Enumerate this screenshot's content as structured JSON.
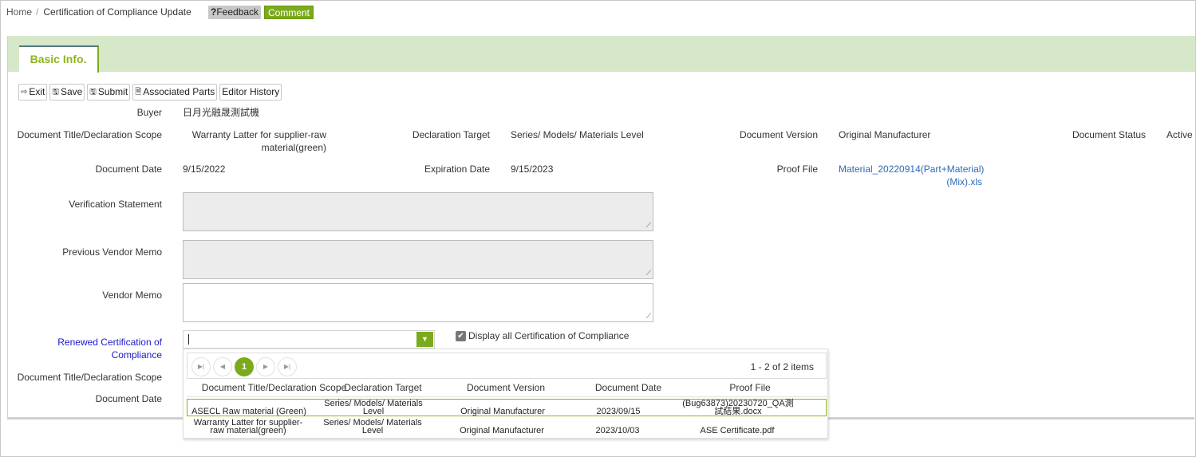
{
  "breadcrumb": {
    "home": "Home",
    "separator": "/",
    "current": "Certification of Compliance Update"
  },
  "header_buttons": {
    "feedback_icon": "?",
    "feedback": "Feedback",
    "comment": "Comment"
  },
  "tabs": [
    {
      "label": "Basic Info.",
      "active": true
    }
  ],
  "toolbar": [
    {
      "label": "Exit",
      "icon": "exit-icon",
      "glyph": "⇨"
    },
    {
      "label": "Save",
      "icon": "save-icon",
      "glyph": "🖫"
    },
    {
      "label": "Submit",
      "icon": "submit-icon",
      "glyph": "🖫"
    },
    {
      "label": "Associated Parts",
      "icon": "document-icon",
      "glyph": "🗎"
    },
    {
      "label": "Editor History",
      "icon": "",
      "glyph": ""
    }
  ],
  "form": {
    "buyer": {
      "label": "Buyer",
      "value": "日月光融晟測試機"
    },
    "doc_title": {
      "label": "Document Title/Declaration Scope",
      "value": "Warranty Latter for supplier-raw material(green)"
    },
    "declaration_target": {
      "label": "Declaration Target",
      "value": "Series/ Models/ Materials Level"
    },
    "doc_version": {
      "label": "Document Version",
      "value": "Original Manufacturer"
    },
    "doc_status": {
      "label": "Document Status",
      "value": "Active"
    },
    "doc_date": {
      "label": "Document Date",
      "value": "9/15/2022"
    },
    "expiration_date": {
      "label": "Expiration Date",
      "value": "9/15/2023"
    },
    "proof_file": {
      "label": "Proof File",
      "value": "Material_20220914(Part+Material)(Mix).xls"
    },
    "verification_statement": {
      "label": "Verification Statement",
      "value": ""
    },
    "previous_vendor_memo": {
      "label": "Previous Vendor Memo",
      "value": ""
    },
    "vendor_memo": {
      "label": "Vendor Memo",
      "value": ""
    },
    "renewed_coc": {
      "label": "Renewed Certification of Compliance",
      "value": ""
    },
    "display_all": {
      "label": "Display all Certification of Compliance",
      "checked": true
    },
    "renewed_doc_title": {
      "label": "Document Title/Declaration Scope"
    },
    "renewed_doc_date": {
      "label": "Document Date"
    }
  },
  "dropdown": {
    "pager": {
      "current_page": "1",
      "info": "1 - 2 of 2 items"
    },
    "columns": [
      "Document Title/Declaration Scope",
      "Declaration Target",
      "Document Version",
      "Document Date",
      "Proof File"
    ],
    "rows": [
      {
        "title": "ASECL Raw material (Green)",
        "target": "Series/ Models/ Materials Level",
        "version": "Original Manufacturer",
        "date": "2023/09/15",
        "proof": "(Bug63873)20230720_QA測試結果.docx",
        "selected": true
      },
      {
        "title": "Warranty Latter for supplier-raw material(green)",
        "target": "Series/ Models/ Materials Level",
        "version": "Original Manufacturer",
        "date": "2023/10/03",
        "proof": "ASE Certificate.pdf",
        "selected": false
      }
    ]
  },
  "colors": {
    "accent": "#7bab1c",
    "tabbar": "#d6e8c9",
    "link": "#2f6bb5"
  }
}
